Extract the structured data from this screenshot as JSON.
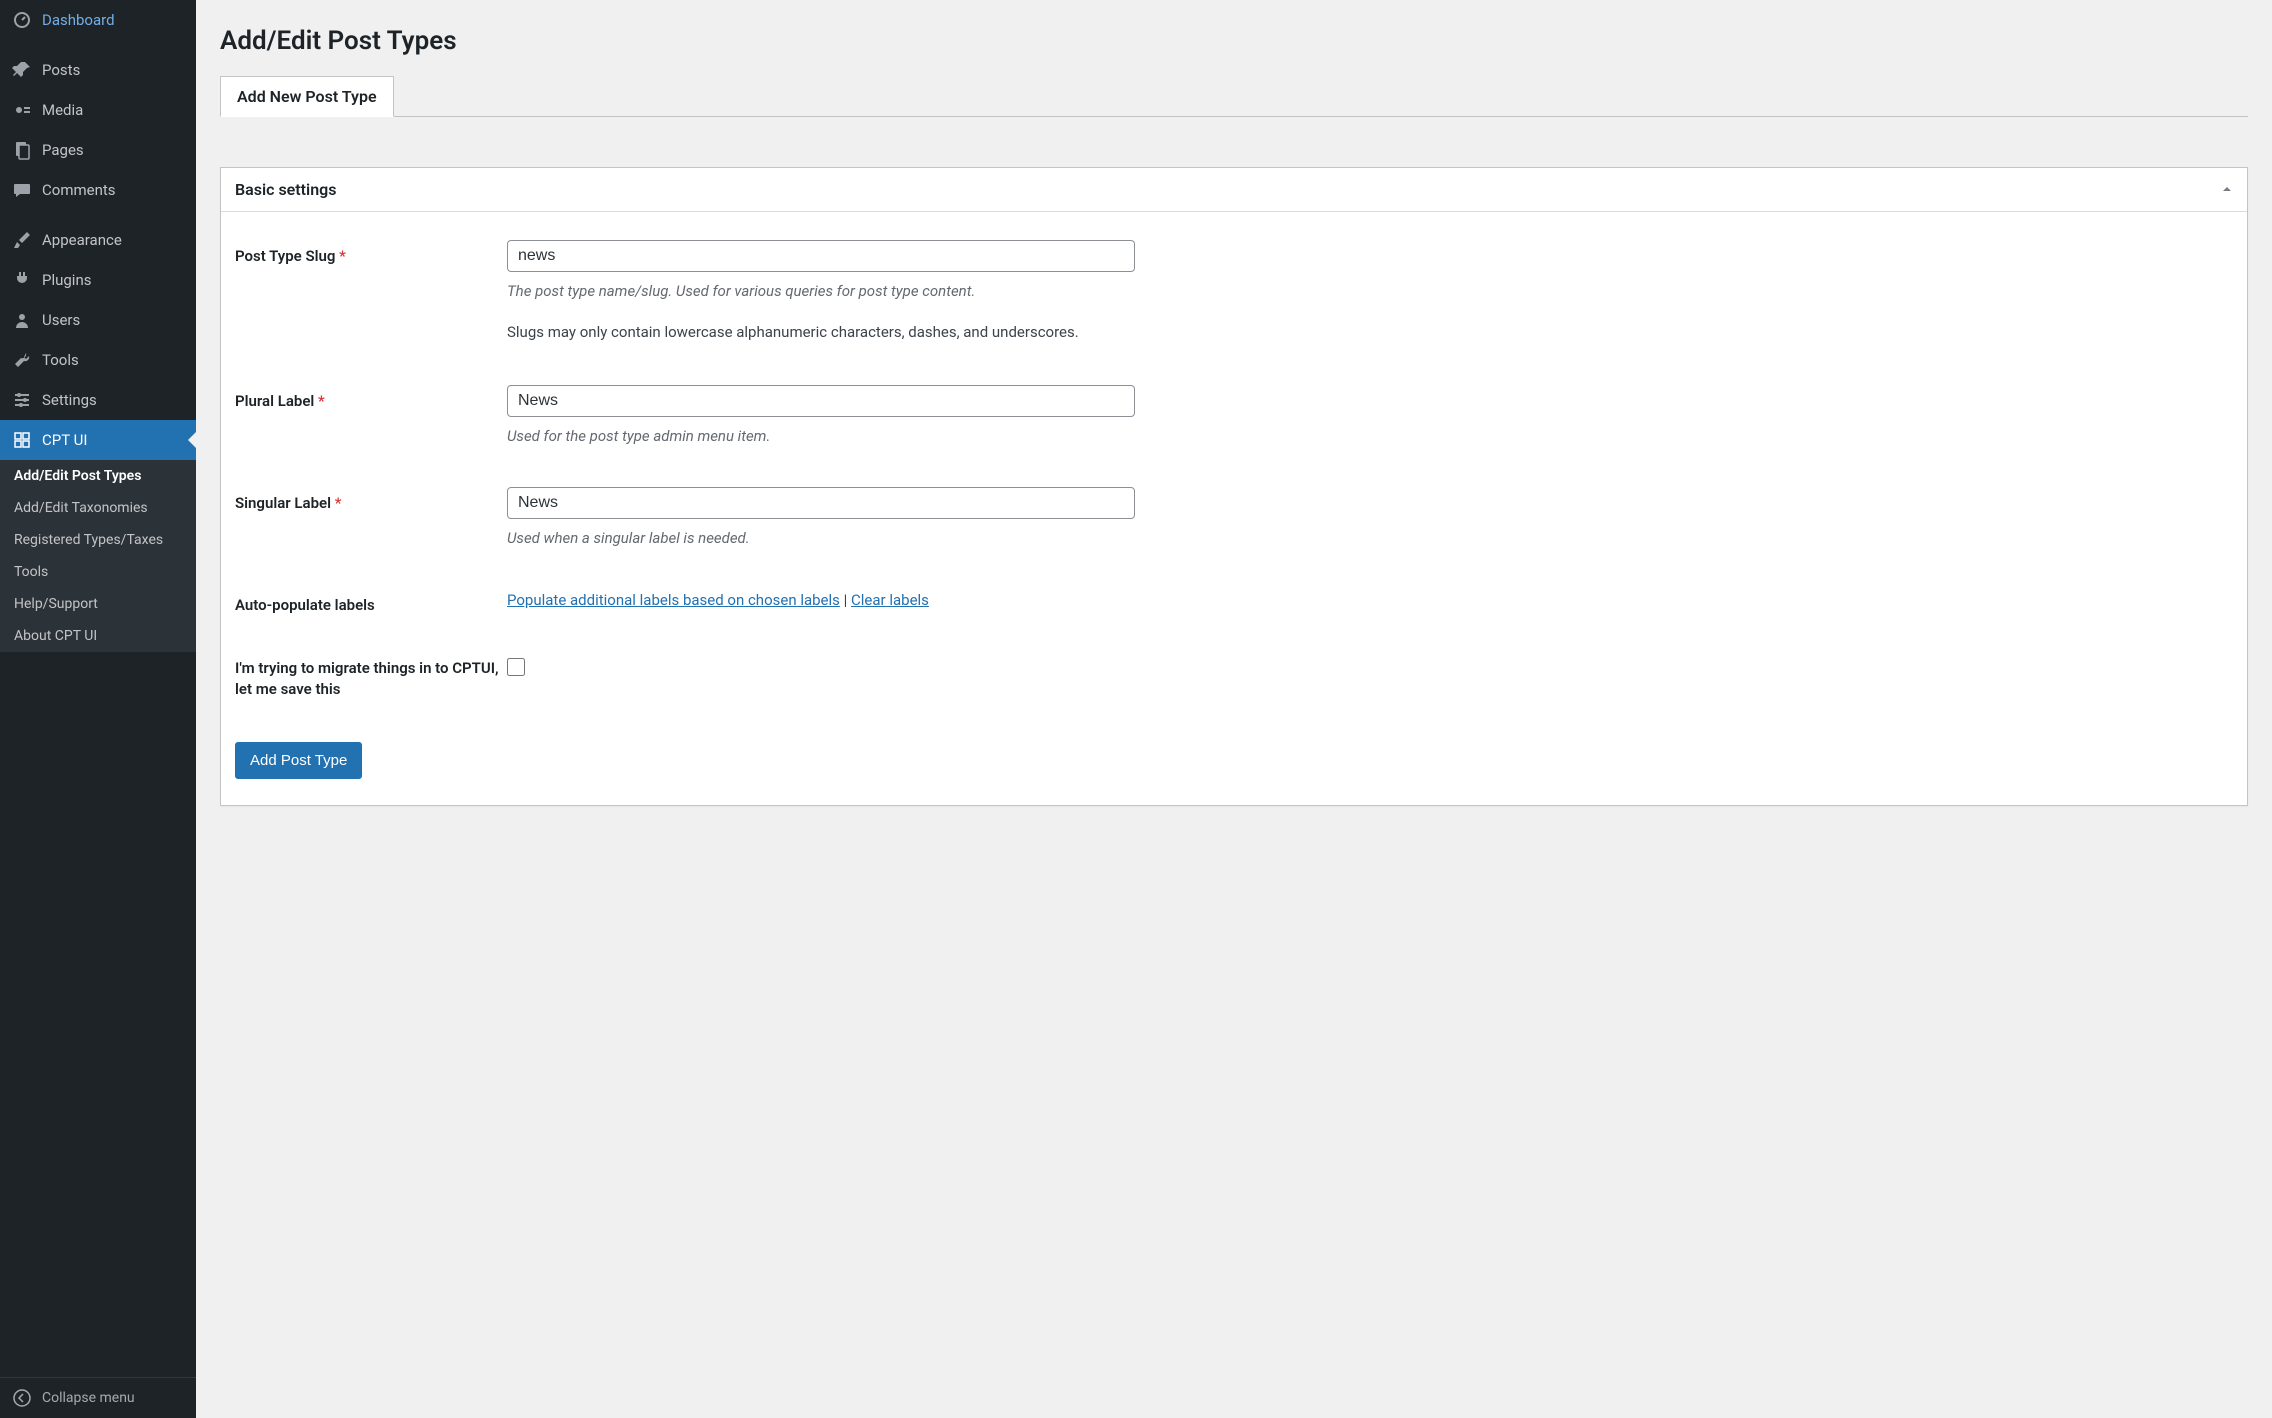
{
  "sidebar": {
    "items": [
      {
        "label": "Dashboard"
      },
      {
        "label": "Posts"
      },
      {
        "label": "Media"
      },
      {
        "label": "Pages"
      },
      {
        "label": "Comments"
      },
      {
        "label": "Appearance"
      },
      {
        "label": "Plugins"
      },
      {
        "label": "Users"
      },
      {
        "label": "Tools"
      },
      {
        "label": "Settings"
      },
      {
        "label": "CPT UI"
      }
    ],
    "submenu": [
      {
        "label": "Add/Edit Post Types"
      },
      {
        "label": "Add/Edit Taxonomies"
      },
      {
        "label": "Registered Types/Taxes"
      },
      {
        "label": "Tools"
      },
      {
        "label": "Help/Support"
      },
      {
        "label": "About CPT UI"
      }
    ],
    "collapse_label": "Collapse menu"
  },
  "page": {
    "title": "Add/Edit Post Types",
    "tab_label": "Add New Post Type"
  },
  "panel": {
    "title": "Basic settings"
  },
  "fields": {
    "slug": {
      "label": "Post Type Slug",
      "value": "news",
      "desc": "The post type name/slug. Used for various queries for post type content.",
      "note": "Slugs may only contain lowercase alphanumeric characters, dashes, and underscores."
    },
    "plural": {
      "label": "Plural Label",
      "value": "News",
      "desc": "Used for the post type admin menu item."
    },
    "singular": {
      "label": "Singular Label",
      "value": "News",
      "desc": "Used when a singular label is needed."
    },
    "autopop": {
      "label": "Auto-populate labels",
      "link_populate": "Populate additional labels based on chosen labels",
      "divider": " | ",
      "link_clear": "Clear labels"
    },
    "migrate": {
      "label": "I'm trying to migrate things in to CPTUI, let me save this"
    }
  },
  "submit": {
    "label": "Add Post Type"
  }
}
